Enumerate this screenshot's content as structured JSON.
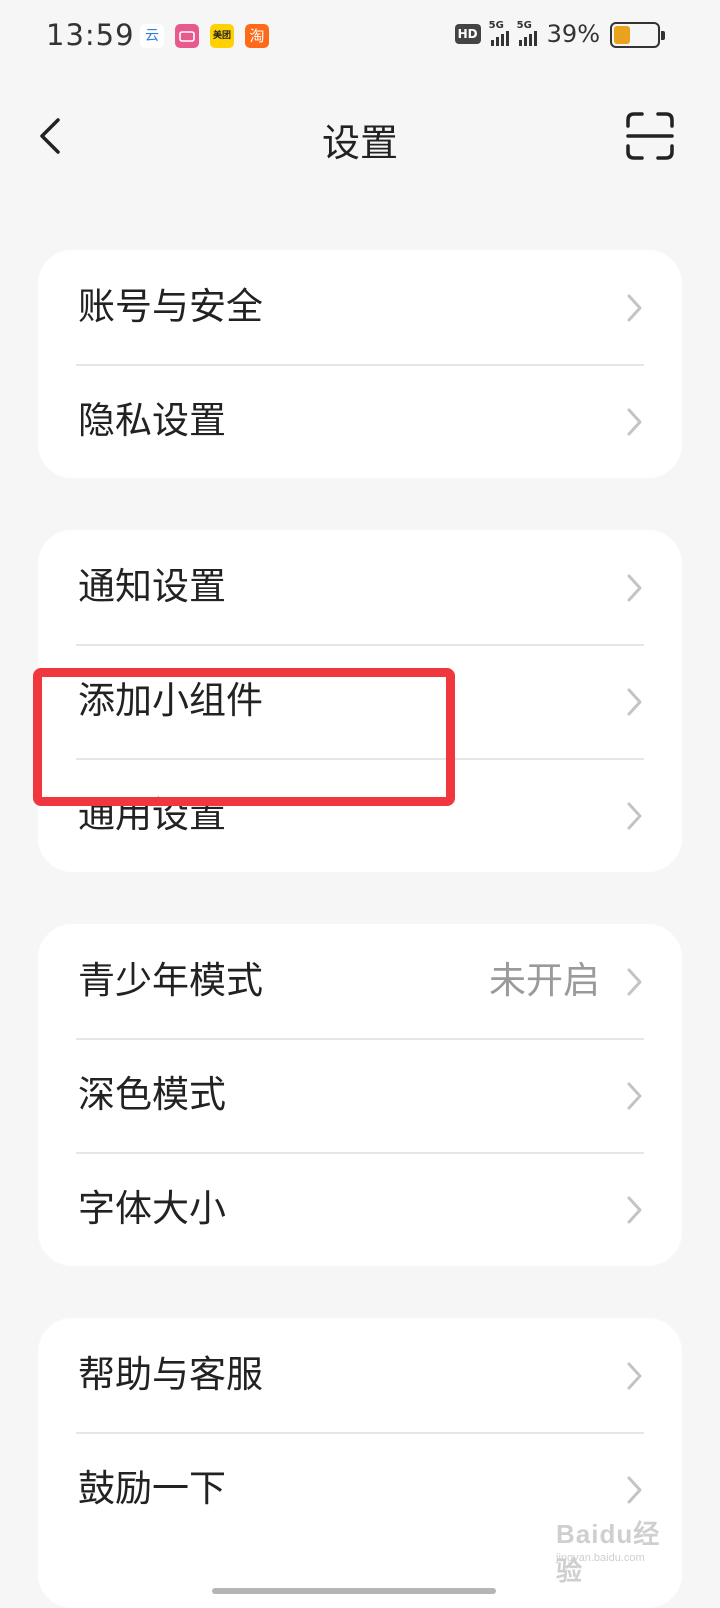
{
  "status_bar": {
    "time": "13:59",
    "app_icons": [
      {
        "name": "cloud-app-icon",
        "text": "云",
        "color": "#ffffff",
        "text_color": "#2f7fd6"
      },
      {
        "name": "photo-app-icon",
        "text": "",
        "color": "#e85a8e",
        "text_color": "#ffffff"
      },
      {
        "name": "meituan-app-icon",
        "text": "美团",
        "color": "#ffd100",
        "text_color": "#222222"
      },
      {
        "name": "taobao-app-icon",
        "text": "淘",
        "color": "#ff6a1a",
        "text_color": "#ffffff"
      }
    ],
    "hd_label": "HD",
    "network_1": "5G",
    "network_2": "5G",
    "battery_percent": "39%",
    "battery_level": 0.39,
    "battery_color": "#e8a21d"
  },
  "header": {
    "title": "设置",
    "back_icon": "chevron-left-icon",
    "scan_icon": "scan-icon"
  },
  "groups": [
    {
      "items": [
        {
          "label": "账号与安全",
          "value": ""
        },
        {
          "label": "隐私设置",
          "value": ""
        }
      ]
    },
    {
      "items": [
        {
          "label": "通知设置",
          "value": ""
        },
        {
          "label": "添加小组件",
          "value": ""
        },
        {
          "label": "通用设置",
          "value": ""
        }
      ]
    },
    {
      "items": [
        {
          "label": "青少年模式",
          "value": "未开启"
        },
        {
          "label": "深色模式",
          "value": ""
        },
        {
          "label": "字体大小",
          "value": ""
        }
      ]
    },
    {
      "items": [
        {
          "label": "帮助与客服",
          "value": ""
        },
        {
          "label": "鼓励一下",
          "value": ""
        }
      ]
    }
  ],
  "annotation": {
    "color": "#f0373d"
  },
  "watermark": {
    "text": "Baidu经验",
    "subtext": "jingyan.baidu.com"
  },
  "colors": {
    "background": "#f6f6f6",
    "card": "#ffffff",
    "chevron": "#c4c4c4"
  }
}
